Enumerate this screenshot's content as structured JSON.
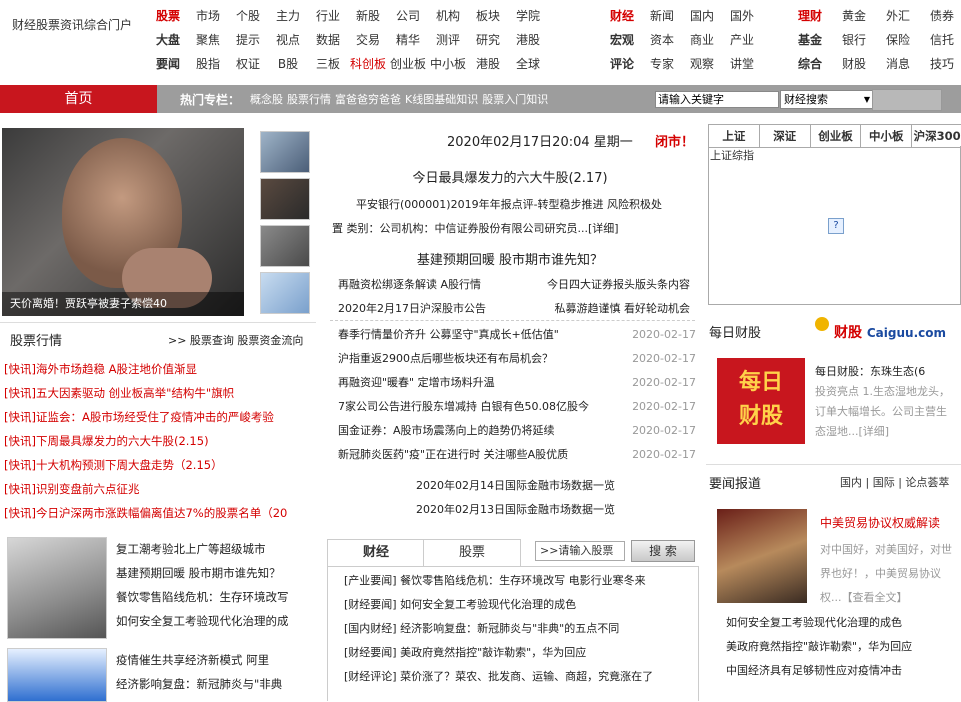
{
  "site_name": "财经股票资讯综合门户",
  "nav_group1": [
    [
      "股票",
      "市场",
      "个股",
      "主力",
      "行业",
      "新股",
      "公司",
      "机构",
      "板块",
      "学院"
    ],
    [
      "大盘",
      "聚焦",
      "提示",
      "视点",
      "数据",
      "交易",
      "精华",
      "测评",
      "研究",
      "港股"
    ],
    [
      "要闻",
      "股指",
      "权证",
      "B股",
      "三板",
      "科创板",
      "创业板",
      "中小板",
      "港股",
      "全球"
    ]
  ],
  "nav_group2": [
    [
      "财经",
      "新闻",
      "国内",
      "国外"
    ],
    [
      "宏观",
      "资本",
      "商业",
      "产业"
    ],
    [
      "评论",
      "专家",
      "观察",
      "讲堂"
    ]
  ],
  "nav_group3": [
    [
      "理财",
      "黄金",
      "外汇",
      "债券"
    ],
    [
      "基金",
      "银行",
      "保险",
      "信托"
    ],
    [
      "综合",
      "财股",
      "消息",
      "技巧"
    ]
  ],
  "home_label": "首页",
  "hot_label": "热门专栏：",
  "hot_links": [
    "概念股",
    "股票行情",
    "富爸爸穷爸爸",
    "K线图基础知识",
    "股票入门知识"
  ],
  "search_placeholder": "请输入关键字",
  "search_select": "财经搜索",
  "photo_caption": "天价离婚！贾跃亭被妻子索偿40",
  "left_section_title": "股票行情",
  "left_section_links": ">> 股票查询 股票资金流向",
  "flash_news": [
    "[快讯]海外市场趋稳 A股注地价值渐显",
    "[快讯]五大因素驱动 创业板高举\"结构牛\"旗帜",
    "[快讯]证监会：A股市场经受住了疫情冲击的严峻考验",
    "[快讯]下周最具爆发力的六大牛股(2.15)",
    "[快讯]十大机构预测下周大盘走势（2.15）",
    "[快讯]识别变盘前六点征兆",
    "[快讯]今日沪深两市涨跌幅偏离值达7%的股票名单（20"
  ],
  "left_list1": [
    "复工潮考验北上广等超级城市",
    "基建预期回暖 股市期市谁先知？",
    "餐饮零售陷线危机：生存环境改写",
    "如何安全复工考验现代化治理的成"
  ],
  "left_list2": [
    "疫情催生共享经济新模式 阿里",
    "经济影响复盘：新冠肺炎与\"非典"
  ],
  "date_line": "2020年02月17日20:04 星期一",
  "market_closed": "闭市！",
  "headline1": "今日最具爆发力的六大牛股(2.17)",
  "headline1_sub1": "平安银行(000001)2019年年报点评-转型稳步推进 风险积极处",
  "headline1_sub2": "置 类别：公司机构：中信证券股份有限公司研究员...[详细]",
  "headline2": "基建预期回暖 股市期市谁先知？",
  "center_pairs": [
    [
      "再融资松绑逐条解读 A股行情",
      "今日四大证券报头版头条内容"
    ],
    [
      "2020年2月17日沪深股市公告",
      "私募游趋谨慎 看好轮动机会"
    ]
  ],
  "news_list": [
    {
      "t": "春季行情量价齐升 公募坚守\"真成长+低估值\"",
      "d": "2020-02-17"
    },
    {
      "t": "沪指重返2900点后哪些板块还有布局机会？",
      "d": "2020-02-17"
    },
    {
      "t": "再融资迎\"暖春\" 定增市场料升温",
      "d": "2020-02-17"
    },
    {
      "t": "7家公司公告进行股东增减持 白银有色50.08亿股今",
      "d": "2020-02-17"
    },
    {
      "t": "国金证券：A股市场震荡向上的趋势仍将延续",
      "d": "2020-02-17"
    },
    {
      "t": "新冠肺炎医药\"疫\"正在进行时 关注哪些A股优质",
      "d": "2020-02-17"
    }
  ],
  "data_links": [
    "2020年02月14日国际金融市场数据一览",
    "2020年02月13日国际金融市场数据一览"
  ],
  "tabs": [
    "财经",
    "股票"
  ],
  "stock_input": ">>请输入股票",
  "search_button": "搜 索",
  "cat_list": [
    "[产业要闻] 餐饮零售陷线危机：生存环境改写 电影行业寒冬来",
    "[财经要闻] 如何安全复工考验现代化治理的成色",
    "[国内财经] 经济影响复盘：新冠肺炎与\"非典\"的五点不同",
    "[财经要闻] 美政府竟然指控\"敲诈勒索\"，华为回应",
    "[财经评论] 菜价涨了？菜农、批发商、运输、商超，究竟涨在了"
  ],
  "market_tabs": [
    "上证",
    "深证",
    "创业板",
    "中小板",
    "沪深300"
  ],
  "market_panel_label": "上证综指",
  "daily_title": "每日财股",
  "brand_cn": "财股",
  "brand_en": "Caiguu.com",
  "daily_box_text": [
    "每日",
    "财股"
  ],
  "daily_item_title": "每日财股：东珠生态(6",
  "daily_item_desc": "投资亮点 1.生态湿地龙头，订单大幅增长。公司主营生态湿地...[详细]",
  "report_title": "要闻报道",
  "report_tabs": "国内 | 国际 | 论点荟萃",
  "report_main_title": "中美贸易协议权威解读",
  "report_main_desc": "对中国好，对美国好，对世界也好！，中美贸易协议权...【查看全文】",
  "right_news": [
    "如何安全复工考验现代化治理的成色",
    "美政府竟然指控\"敲诈勒索\"，华为回应",
    "中国经济具有足够韧性应对疫情冲击"
  ]
}
